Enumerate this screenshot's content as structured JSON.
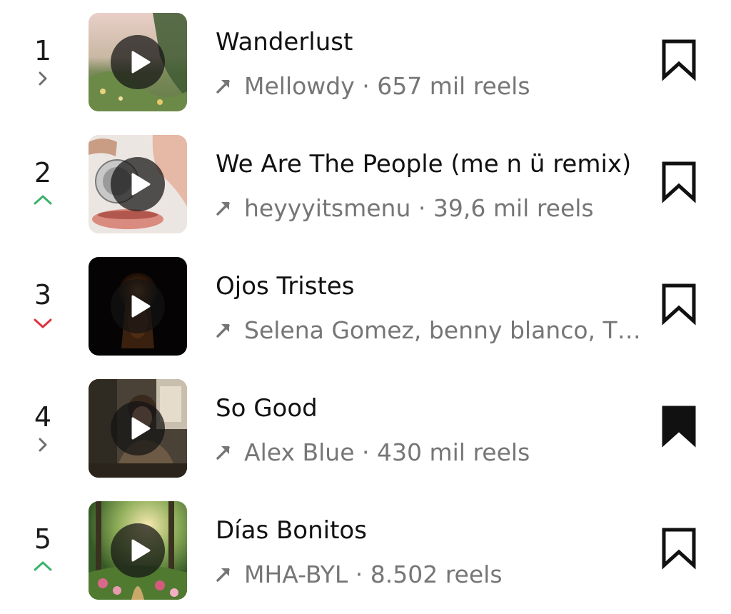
{
  "colors": {
    "trend_up": "#3bb36a",
    "trend_down": "#e0323e",
    "trend_same": "#6f6f6f",
    "meta_text": "#767676",
    "title_text": "#111111"
  },
  "tracks": [
    {
      "rank": "1",
      "trend": "same",
      "trend_icon": "chevron-right-icon",
      "title": "Wanderlust",
      "artist": "Mellowdy",
      "separator": " · ",
      "reels": "657 mil reels",
      "saved": false
    },
    {
      "rank": "2",
      "trend": "up",
      "trend_icon": "chevron-up-icon",
      "title": "We Are The People (me n ü remix)",
      "artist": "heyyyitsmenu",
      "separator": " · ",
      "reels": "39,6 mil reels",
      "saved": false
    },
    {
      "rank": "3",
      "trend": "down",
      "trend_icon": "chevron-down-icon",
      "title": "Ojos Tristes",
      "artist": "Selena Gomez, benny blanco, Th...",
      "separator": "",
      "reels": "",
      "saved": false
    },
    {
      "rank": "4",
      "trend": "same",
      "trend_icon": "chevron-right-icon",
      "title": "So Good",
      "artist": "Alex Blue",
      "separator": " · ",
      "reels": "430 mil reels",
      "saved": true
    },
    {
      "rank": "5",
      "trend": "up",
      "trend_icon": "chevron-up-icon",
      "title": "Días Bonitos",
      "artist": "MHA-BYL",
      "separator": " · ",
      "reels": "8.502 reels",
      "saved": false
    }
  ]
}
